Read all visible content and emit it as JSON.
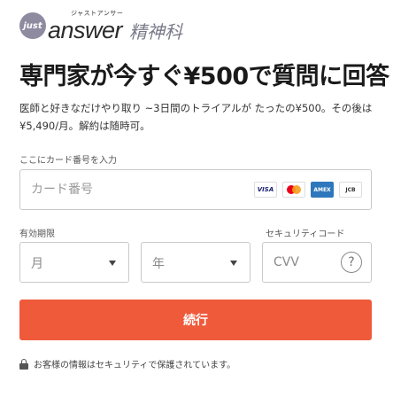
{
  "brand": {
    "badge": "just",
    "name": "answer",
    "ruby": "ジャストアンサー",
    "subtitle": "精神科"
  },
  "headline": "専門家が今すぐ¥500で質問に回答",
  "description": "医師と好きなだけやり取り ~3日間のトライアルが たったの¥500。その後は¥5,490/月。解約は随時可。",
  "card": {
    "label": "ここにカード番号を入力",
    "placeholder": "カード番号",
    "brands": [
      "VISA",
      "Mastercard",
      "AMEX",
      "JCB"
    ],
    "brand_icons": [
      "visa-icon",
      "mastercard-icon",
      "amex-icon",
      "jcb-icon"
    ]
  },
  "expiry": {
    "label": "有効期限",
    "month_placeholder": "月",
    "year_placeholder": "年"
  },
  "cvv": {
    "label": "セキュリティコード",
    "placeholder": "CVV",
    "help_symbol": "?"
  },
  "submit_label": "続行",
  "secure_note": "お客様の情報はセキュリティで保護されています。",
  "colors": {
    "accent": "#ef5a3b",
    "border": "#c9c9c9"
  }
}
